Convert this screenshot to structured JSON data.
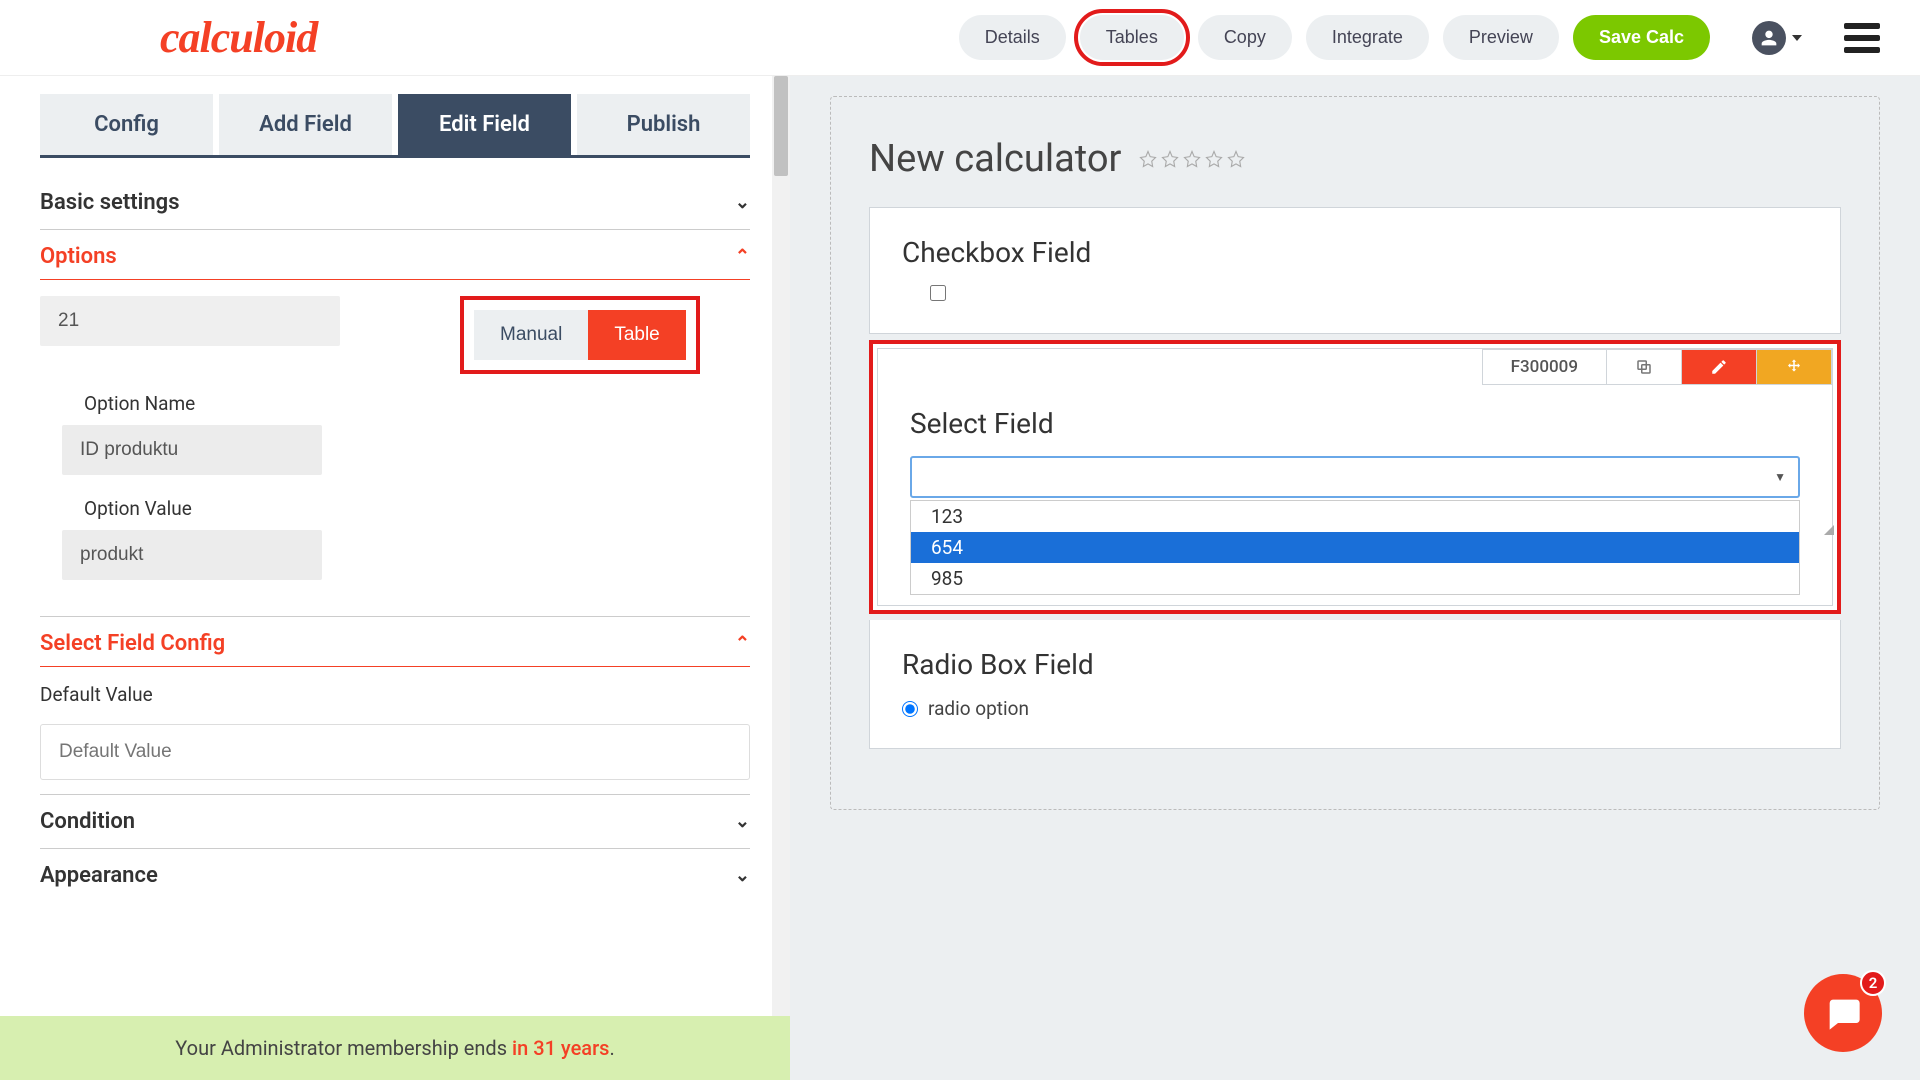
{
  "logo": "calculoid",
  "nav": {
    "details": "Details",
    "tables": "Tables",
    "copy": "Copy",
    "integrate": "Integrate",
    "preview": "Preview",
    "save": "Save Calc"
  },
  "tabs": {
    "config": "Config",
    "add_field": "Add Field",
    "edit_field": "Edit Field",
    "publish": "Publish"
  },
  "sections": {
    "basic": "Basic settings",
    "options": "Options",
    "select_config": "Select Field Config",
    "condition": "Condition",
    "appearance": "Appearance"
  },
  "options": {
    "number_value": "21",
    "toggle_manual": "Manual",
    "toggle_table": "Table",
    "option_name_label": "Option Name",
    "option_name_value": "ID produktu",
    "option_value_label": "Option Value",
    "option_value_value": "produkt"
  },
  "select_config": {
    "default_label": "Default Value",
    "default_placeholder": "Default Value"
  },
  "calc": {
    "title": "New calculator",
    "checkbox_title": "Checkbox Field",
    "select_title": "Select Field",
    "field_id": "F300009",
    "dropdown": [
      "123",
      "654",
      "985"
    ],
    "radio_title": "Radio Box Field",
    "radio_option": "radio option"
  },
  "footer": {
    "text": "Your Administrator membership ends ",
    "em": "in 31 years",
    "dot": "."
  },
  "chat_badge": "2"
}
